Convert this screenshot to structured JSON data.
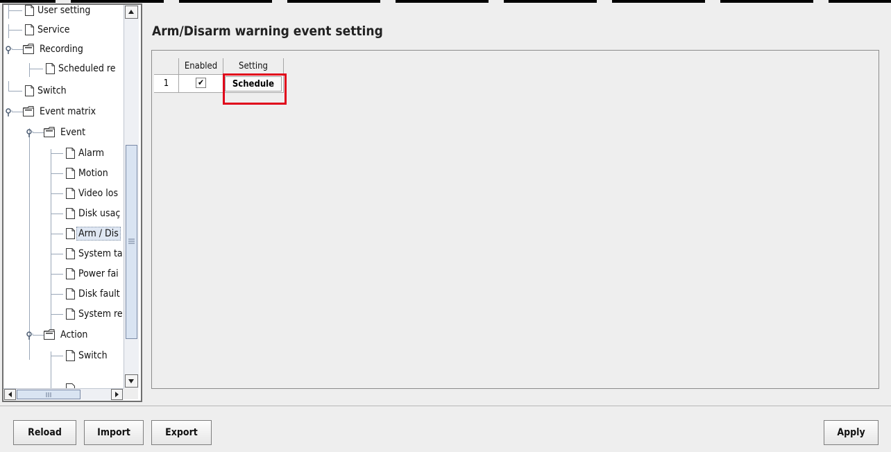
{
  "page_title": "Arm/Disarm warning event setting",
  "tree": {
    "items": [
      {
        "label": "User setting",
        "type": "doc"
      },
      {
        "label": "Service",
        "type": "doc"
      },
      {
        "label": "Recording",
        "type": "folder"
      },
      {
        "label": "Scheduled re",
        "type": "doc"
      },
      {
        "label": "Switch",
        "type": "doc"
      },
      {
        "label": "Event matrix",
        "type": "folder"
      },
      {
        "label": "Event",
        "type": "folder"
      },
      {
        "label": "Alarm",
        "type": "doc"
      },
      {
        "label": "Motion",
        "type": "doc"
      },
      {
        "label": "Video los",
        "type": "doc"
      },
      {
        "label": "Disk usaç",
        "type": "doc"
      },
      {
        "label": "Arm / Dis",
        "type": "doc",
        "selected": true
      },
      {
        "label": "System ta",
        "type": "doc"
      },
      {
        "label": "Power fai",
        "type": "doc"
      },
      {
        "label": "Disk fault",
        "type": "doc"
      },
      {
        "label": "System re",
        "type": "doc"
      },
      {
        "label": "Action",
        "type": "folder"
      },
      {
        "label": "Switch",
        "type": "doc"
      }
    ]
  },
  "table": {
    "headers": [
      "",
      "Enabled",
      "Setting"
    ],
    "rows": [
      {
        "index": "1",
        "enabled": true,
        "enabled_mark": "✔",
        "setting_label": "Schedule"
      }
    ]
  },
  "buttons": {
    "reload": "Reload",
    "import": "Import",
    "export": "Export",
    "apply": "Apply"
  },
  "colors": {
    "highlight": "#e0001a",
    "panel_bg": "#eeeeee"
  }
}
